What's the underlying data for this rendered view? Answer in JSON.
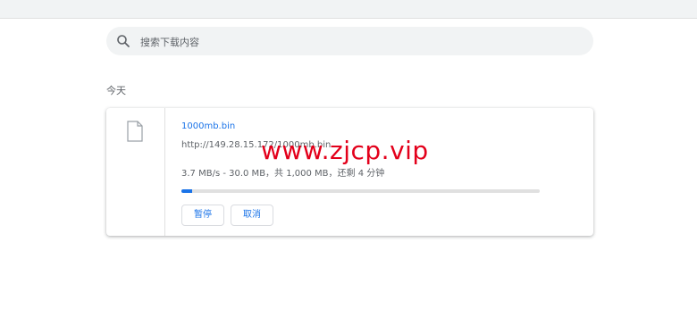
{
  "search": {
    "placeholder": "搜索下载内容"
  },
  "date_header": "今天",
  "download": {
    "file_name": "1000mb.bin",
    "url": "http://149.28.15.172/1000mb.bin",
    "status": "3.7 MB/s - 30.0 MB，共 1,000 MB，还剩 4 分钟",
    "progress_fraction": 0.03,
    "pause_label": "暂停",
    "cancel_label": "取消"
  },
  "watermark": "www.zjcp.vip",
  "colors": {
    "accent": "#1a73e8",
    "watermark": "#e3001b"
  }
}
